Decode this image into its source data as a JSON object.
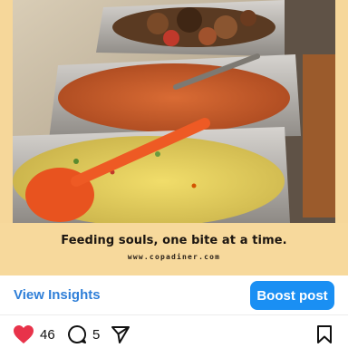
{
  "post": {
    "tagline": "Feeding souls, one bite at a time.",
    "website": "www.copadiner.com"
  },
  "insights": {
    "view_label": "View Insights",
    "boost_label": "Boost post"
  },
  "actions": {
    "likes": "46",
    "comments": "5"
  },
  "colors": {
    "accent": "#1a8ff3",
    "link": "#2f7fd8",
    "like": "#e8334a",
    "banner": "#f7d99c"
  },
  "icons": [
    "heart-icon",
    "comment-icon",
    "share-icon",
    "bookmark-icon"
  ]
}
